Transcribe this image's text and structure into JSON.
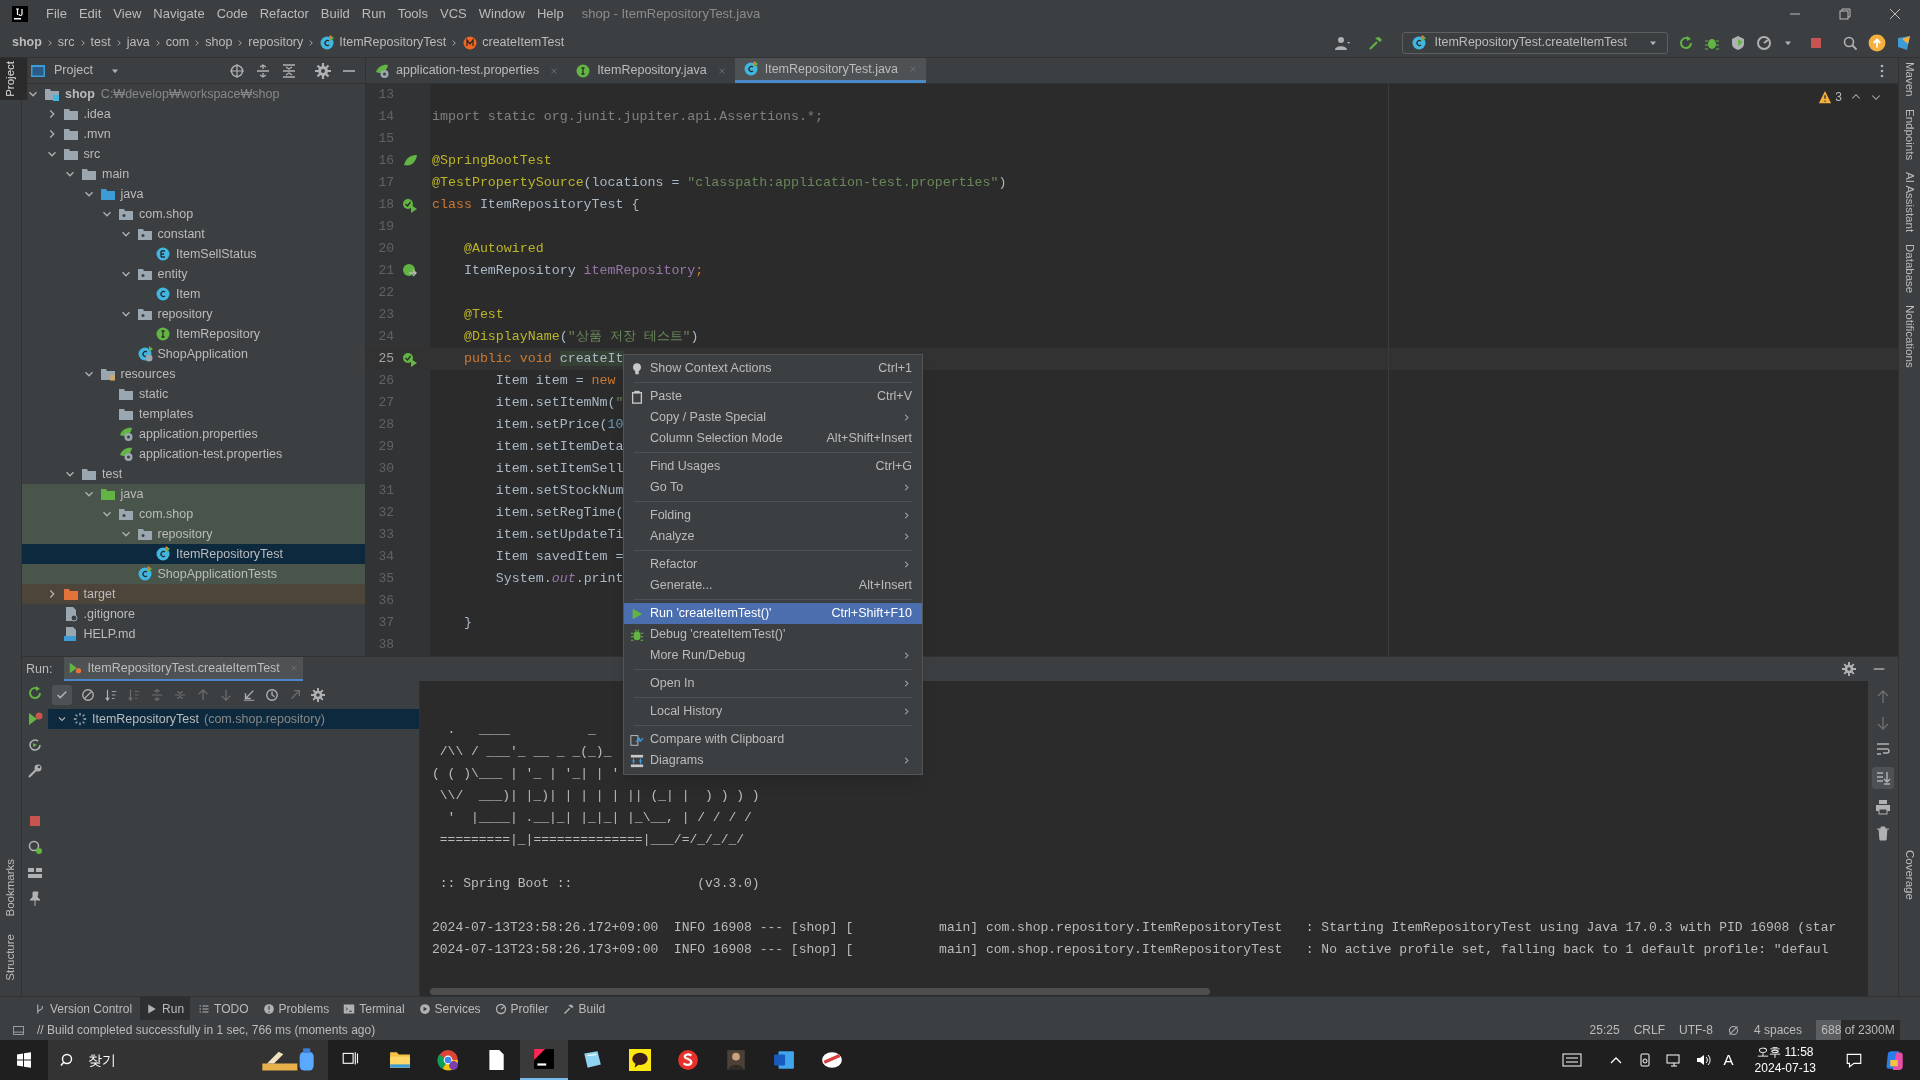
{
  "menu_bar": {
    "items": [
      "File",
      "Edit",
      "View",
      "Navigate",
      "Code",
      "Refactor",
      "Build",
      "Run",
      "Tools",
      "VCS",
      "Window",
      "Help"
    ],
    "title": "shop - ItemRepositoryTest.java"
  },
  "breadcrumbs": [
    {
      "label": "shop",
      "kind": "text"
    },
    {
      "label": "src",
      "kind": "text"
    },
    {
      "label": "test",
      "kind": "text"
    },
    {
      "label": "java",
      "kind": "text"
    },
    {
      "label": "com",
      "kind": "text"
    },
    {
      "label": "shop",
      "kind": "text"
    },
    {
      "label": "repository",
      "kind": "text"
    },
    {
      "label": "ItemRepositoryTest",
      "kind": "class"
    },
    {
      "label": "createItemTest",
      "kind": "method"
    }
  ],
  "run_config": {
    "label": "ItemRepositoryTest.createItemTest"
  },
  "left_stripe": {
    "top": [
      {
        "label": "Project",
        "selected": true
      }
    ],
    "bottom": [
      {
        "label": "Bookmarks",
        "selected": false
      },
      {
        "label": "Structure",
        "selected": false
      }
    ]
  },
  "right_stripe": [
    {
      "label": "Maven"
    },
    {
      "label": "Endpoints"
    },
    {
      "label": "AI Assistant"
    },
    {
      "label": "Database"
    },
    {
      "label": "Notifications"
    },
    {
      "label": "Coverage"
    }
  ],
  "project_panel": {
    "title": "Project",
    "tree": [
      {
        "label": "shop",
        "path": "C:₩develop₩workspace₩shop",
        "kind": "module",
        "expanded": true,
        "selected": false,
        "children": [
          {
            "label": ".idea",
            "kind": "folder",
            "expanded": false,
            "selected": false
          },
          {
            "label": ".mvn",
            "kind": "folder",
            "expanded": false,
            "selected": false
          },
          {
            "label": "src",
            "kind": "folder",
            "expanded": true,
            "selected": false,
            "children": [
              {
                "label": "main",
                "kind": "folder",
                "expanded": true,
                "selected": false,
                "children": [
                  {
                    "label": "java",
                    "kind": "source-folder",
                    "expanded": true,
                    "selected": false,
                    "children": [
                      {
                        "label": "com.shop",
                        "kind": "package",
                        "expanded": true,
                        "selected": false,
                        "children": [
                          {
                            "label": "constant",
                            "kind": "package",
                            "expanded": true,
                            "selected": false,
                            "children": [
                              {
                                "label": "ItemSellStatus",
                                "kind": "enum",
                                "selected": false
                              }
                            ]
                          },
                          {
                            "label": "entity",
                            "kind": "package",
                            "expanded": true,
                            "selected": false,
                            "children": [
                              {
                                "label": "Item",
                                "kind": "class",
                                "selected": false
                              }
                            ]
                          },
                          {
                            "label": "repository",
                            "kind": "package",
                            "expanded": true,
                            "selected": false,
                            "children": [
                              {
                                "label": "ItemRepository",
                                "kind": "interface",
                                "selected": false
                              }
                            ]
                          },
                          {
                            "label": "ShopApplication",
                            "kind": "spring-class",
                            "selected": false
                          }
                        ]
                      }
                    ]
                  },
                  {
                    "label": "resources",
                    "kind": "resources-folder",
                    "expanded": true,
                    "selected": false,
                    "children": [
                      {
                        "label": "static",
                        "kind": "folder",
                        "selected": false
                      },
                      {
                        "label": "templates",
                        "kind": "folder",
                        "selected": false
                      },
                      {
                        "label": "application.properties",
                        "kind": "properties",
                        "selected": false
                      },
                      {
                        "label": "application-test.properties",
                        "kind": "properties",
                        "selected": false
                      }
                    ]
                  }
                ]
              },
              {
                "label": "test",
                "kind": "folder",
                "expanded": true,
                "selected": false,
                "children": [
                  {
                    "label": "java",
                    "kind": "test-folder",
                    "expanded": true,
                    "selected": false,
                    "test_source": true,
                    "children": [
                      {
                        "label": "com.shop",
                        "kind": "package",
                        "expanded": true,
                        "selected": false,
                        "test_source": true,
                        "children": [
                          {
                            "label": "repository",
                            "kind": "package",
                            "expanded": true,
                            "selected": false,
                            "test_source": true,
                            "children": [
                              {
                                "label": "ItemRepositoryTest",
                                "kind": "test-class",
                                "selected": true
                              }
                            ]
                          },
                          {
                            "label": "ShopApplicationTests",
                            "kind": "test-class",
                            "selected": false,
                            "test_source": true
                          }
                        ]
                      }
                    ]
                  }
                ]
              }
            ]
          },
          {
            "label": "target",
            "kind": "excluded-folder",
            "expanded": false,
            "selected": false,
            "excluded": true
          },
          {
            "label": ".gitignore",
            "kind": "file",
            "selected": false
          },
          {
            "label": "HELP.md",
            "kind": "markdown",
            "selected": false
          }
        ]
      }
    ]
  },
  "editor": {
    "tabs": [
      {
        "label": "application-test.properties",
        "kind": "properties",
        "selected": false
      },
      {
        "label": "ItemRepository.java",
        "kind": "interface",
        "selected": false
      },
      {
        "label": "ItemRepositoryTest.java",
        "kind": "test-class",
        "selected": true
      }
    ],
    "warnings": "3",
    "lines": [
      {
        "n": "13",
        "current": false
      },
      {
        "n": "14",
        "current": false,
        "tokens": [
          {
            "t": "import static org.junit.jupiter.api.Assertions.*;",
            "kind": "unused"
          }
        ]
      },
      {
        "n": "15",
        "current": false
      },
      {
        "n": "16",
        "current": false,
        "gutter": {
          "kind": "leaf"
        },
        "tokens": [
          {
            "t": "@SpringBootTest",
            "kind": "ann"
          }
        ]
      },
      {
        "n": "17",
        "current": false,
        "tokens": [
          {
            "t": "@TestPropertySource",
            "kind": "ann"
          },
          {
            "t": "(locations = ",
            "kind": "plain"
          },
          {
            "t": "\"classpath:application-test.properties\"",
            "kind": "str"
          },
          {
            "t": ")",
            "kind": "plain"
          }
        ]
      },
      {
        "n": "18",
        "current": false,
        "gutter": {
          "kind": "run"
        },
        "tokens": [
          {
            "t": "class",
            "kind": "kw"
          },
          {
            "t": " ItemRepositoryTest {",
            "kind": "plain"
          }
        ]
      },
      {
        "n": "19",
        "current": false
      },
      {
        "n": "20",
        "current": false,
        "tokens": [
          {
            "t": "    @Autowired",
            "kind": "ann"
          }
        ]
      },
      {
        "n": "21",
        "current": false,
        "gutter": {
          "kind": "bean"
        },
        "tokens": [
          {
            "t": "    ItemRepository ",
            "kind": "plain"
          },
          {
            "t": "itemRepository",
            "kind": "field"
          },
          {
            "t": ";",
            "kind": "kw"
          }
        ]
      },
      {
        "n": "22",
        "current": false
      },
      {
        "n": "23",
        "current": false,
        "tokens": [
          {
            "t": "    @Test",
            "kind": "ann"
          }
        ]
      },
      {
        "n": "24",
        "current": false,
        "tokens": [
          {
            "t": "    @DisplayName",
            "kind": "ann"
          },
          {
            "t": "(",
            "kind": "plain"
          },
          {
            "t": "\"상품 저장 테스트\"",
            "kind": "str"
          },
          {
            "t": ")",
            "kind": "plain"
          }
        ]
      },
      {
        "n": "25",
        "current": true,
        "gutter": {
          "kind": "run"
        },
        "tokens": [
          {
            "t": "    public void ",
            "kind": "kw"
          },
          {
            "t": "createIt",
            "kind": "match"
          }
        ]
      },
      {
        "n": "26",
        "current": false,
        "tokens": [
          {
            "t": "        Item item = ",
            "kind": "plain"
          },
          {
            "t": "new",
            "kind": "kw"
          }
        ]
      },
      {
        "n": "27",
        "current": false,
        "tokens": [
          {
            "t": "        item.setItemNm(",
            "kind": "plain"
          },
          {
            "t": "\"",
            "kind": "str"
          }
        ]
      },
      {
        "n": "28",
        "current": false,
        "tokens": [
          {
            "t": "        item.setPrice(",
            "kind": "plain"
          },
          {
            "t": "10",
            "kind": "num"
          }
        ]
      },
      {
        "n": "29",
        "current": false,
        "tokens": [
          {
            "t": "        item.setItemDeta",
            "kind": "plain"
          }
        ]
      },
      {
        "n": "30",
        "current": false,
        "tokens": [
          {
            "t": "        item.setItemSell",
            "kind": "plain"
          }
        ]
      },
      {
        "n": "31",
        "current": false,
        "tokens": [
          {
            "t": "        item.setStockNum",
            "kind": "plain"
          }
        ]
      },
      {
        "n": "32",
        "current": false,
        "tokens": [
          {
            "t": "        item.setRegTime(",
            "kind": "plain"
          }
        ]
      },
      {
        "n": "33",
        "current": false,
        "tokens": [
          {
            "t": "        item.setUpdateTi",
            "kind": "plain"
          }
        ]
      },
      {
        "n": "34",
        "current": false,
        "tokens": [
          {
            "t": "        Item savedItem =",
            "kind": "plain"
          }
        ]
      },
      {
        "n": "35",
        "current": false,
        "tokens": [
          {
            "t": "        System.",
            "kind": "plain"
          },
          {
            "t": "out",
            "kind": "static"
          },
          {
            "t": ".print",
            "kind": "plain"
          }
        ]
      },
      {
        "n": "36",
        "current": false
      },
      {
        "n": "37",
        "current": false,
        "tokens": [
          {
            "t": "    }",
            "kind": "plain"
          }
        ]
      },
      {
        "n": "38",
        "current": false
      }
    ]
  },
  "context_menu": {
    "groups": [
      [
        {
          "label": "Show Context Actions",
          "shortcut": "Ctrl+1",
          "kind": "bulb",
          "submenu": false,
          "selected": false
        }
      ],
      [
        {
          "label": "Paste",
          "shortcut": "Ctrl+V",
          "kind": "paste",
          "submenu": false,
          "selected": false
        },
        {
          "label": "Copy / Paste Special",
          "kind": "plain",
          "submenu": true,
          "selected": false
        },
        {
          "label": "Column Selection Mode",
          "shortcut": "Alt+Shift+Insert",
          "kind": "plain",
          "submenu": false,
          "selected": false
        }
      ],
      [
        {
          "label": "Find Usages",
          "shortcut": "Ctrl+G",
          "kind": "plain",
          "submenu": false,
          "selected": false
        },
        {
          "label": "Go To",
          "kind": "plain",
          "submenu": true,
          "selected": false
        }
      ],
      [
        {
          "label": "Folding",
          "kind": "plain",
          "submenu": true,
          "selected": false
        },
        {
          "label": "Analyze",
          "kind": "plain",
          "submenu": true,
          "selected": false
        }
      ],
      [
        {
          "label": "Refactor",
          "kind": "plain",
          "submenu": true,
          "selected": false
        },
        {
          "label": "Generate...",
          "shortcut": "Alt+Insert",
          "kind": "plain",
          "submenu": false,
          "selected": false
        }
      ],
      [
        {
          "label": "Run 'createItemTest()'",
          "shortcut": "Ctrl+Shift+F10",
          "kind": "run",
          "submenu": false,
          "selected": true
        },
        {
          "label": "Debug 'createItemTest()'",
          "kind": "debug",
          "submenu": false,
          "selected": false
        },
        {
          "label": "More Run/Debug",
          "kind": "plain",
          "submenu": true,
          "selected": false
        }
      ],
      [
        {
          "label": "Open In",
          "kind": "plain",
          "submenu": true,
          "selected": false
        }
      ],
      [
        {
          "label": "Local History",
          "kind": "plain",
          "submenu": true,
          "selected": false
        }
      ],
      [
        {
          "label": "Compare with Clipboard",
          "kind": "compare",
          "submenu": false,
          "selected": false
        },
        {
          "label": "Diagrams",
          "kind": "diagram",
          "submenu": true,
          "selected": false
        }
      ]
    ]
  },
  "run_panel": {
    "label": "Run:",
    "tab": "ItemRepositoryTest.createItemTest",
    "test_tree": [
      {
        "label": "ItemRepositoryTest",
        "package": "(com.shop.repository)",
        "selected": true
      }
    ],
    "console": [
      {
        "t": "  .   ____          _",
        "kind": "banner"
      },
      {
        "t": " /\\\\ / ___'_ __ _ _(_)_",
        "kind": "banner"
      },
      {
        "t": "( ( )\\___ | '_ | '_| | '",
        "kind": "banner"
      },
      {
        "t": " \\\\/  ___)| |_)| | | | | || (_| |  ) ) ) )",
        "kind": "banner"
      },
      {
        "t": "  '  |____| .__|_| |_|_| |_\\__, | / / / /",
        "kind": "banner"
      },
      {
        "t": " =========|_|==============|___/=/_/_/_/",
        "kind": "banner"
      },
      {
        "kind": "blank"
      },
      {
        "t": " :: Spring Boot ::                (v3.3.0)",
        "kind": "banner"
      },
      {
        "kind": "blank"
      },
      {
        "t": "2024-07-13T23:58:26.172+09:00  INFO 16908 --- [shop] [           main] com.shop.repository.ItemRepositoryTest   : Starting ItemRepositoryTest using Java 17.0.3 with PID 16908 (star",
        "kind": "log"
      },
      {
        "t": "2024-07-13T23:58:26.173+09:00  INFO 16908 --- [shop] [           main] com.shop.repository.ItemRepositoryTest   : No active profile set, falling back to 1 default profile: \"defaul",
        "kind": "log"
      }
    ]
  },
  "tool_tabs": [
    {
      "label": "Version Control",
      "kind": "vcs",
      "selected": false
    },
    {
      "label": "Run",
      "kind": "run",
      "selected": true
    },
    {
      "label": "TODO",
      "kind": "todo",
      "selected": false
    },
    {
      "label": "Problems",
      "kind": "problems",
      "selected": false
    },
    {
      "label": "Terminal",
      "kind": "terminal",
      "selected": false
    },
    {
      "label": "Services",
      "kind": "services",
      "selected": false
    },
    {
      "label": "Profiler",
      "kind": "profiler",
      "selected": false
    },
    {
      "label": "Build",
      "kind": "build",
      "selected": false
    }
  ],
  "status_bar": {
    "message": "// Build completed successfully in 1 sec, 766 ms (moments ago)",
    "position": "25:25",
    "line_separator": "CRLF",
    "encoding": "UTF-8",
    "indent": "4 spaces",
    "memory": {
      "text": "688 of 2300M",
      "level": 0.3
    }
  },
  "taskbar": {
    "search": "찾기",
    "apps": [
      {
        "kind": "task-view",
        "selected": false
      },
      {
        "kind": "folder",
        "selected": false
      },
      {
        "kind": "browser",
        "selected": false
      },
      {
        "kind": "document",
        "selected": false
      },
      {
        "kind": "ide",
        "selected": true
      },
      {
        "kind": "notepad",
        "selected": false
      },
      {
        "kind": "chat",
        "selected": false
      },
      {
        "kind": "app",
        "selected": false
      },
      {
        "kind": "figure",
        "selected": false
      },
      {
        "kind": "word",
        "selected": false
      },
      {
        "kind": "tool",
        "selected": false
      }
    ],
    "ime": "A",
    "time": "오후 11:58",
    "date": "2024-07-13"
  }
}
